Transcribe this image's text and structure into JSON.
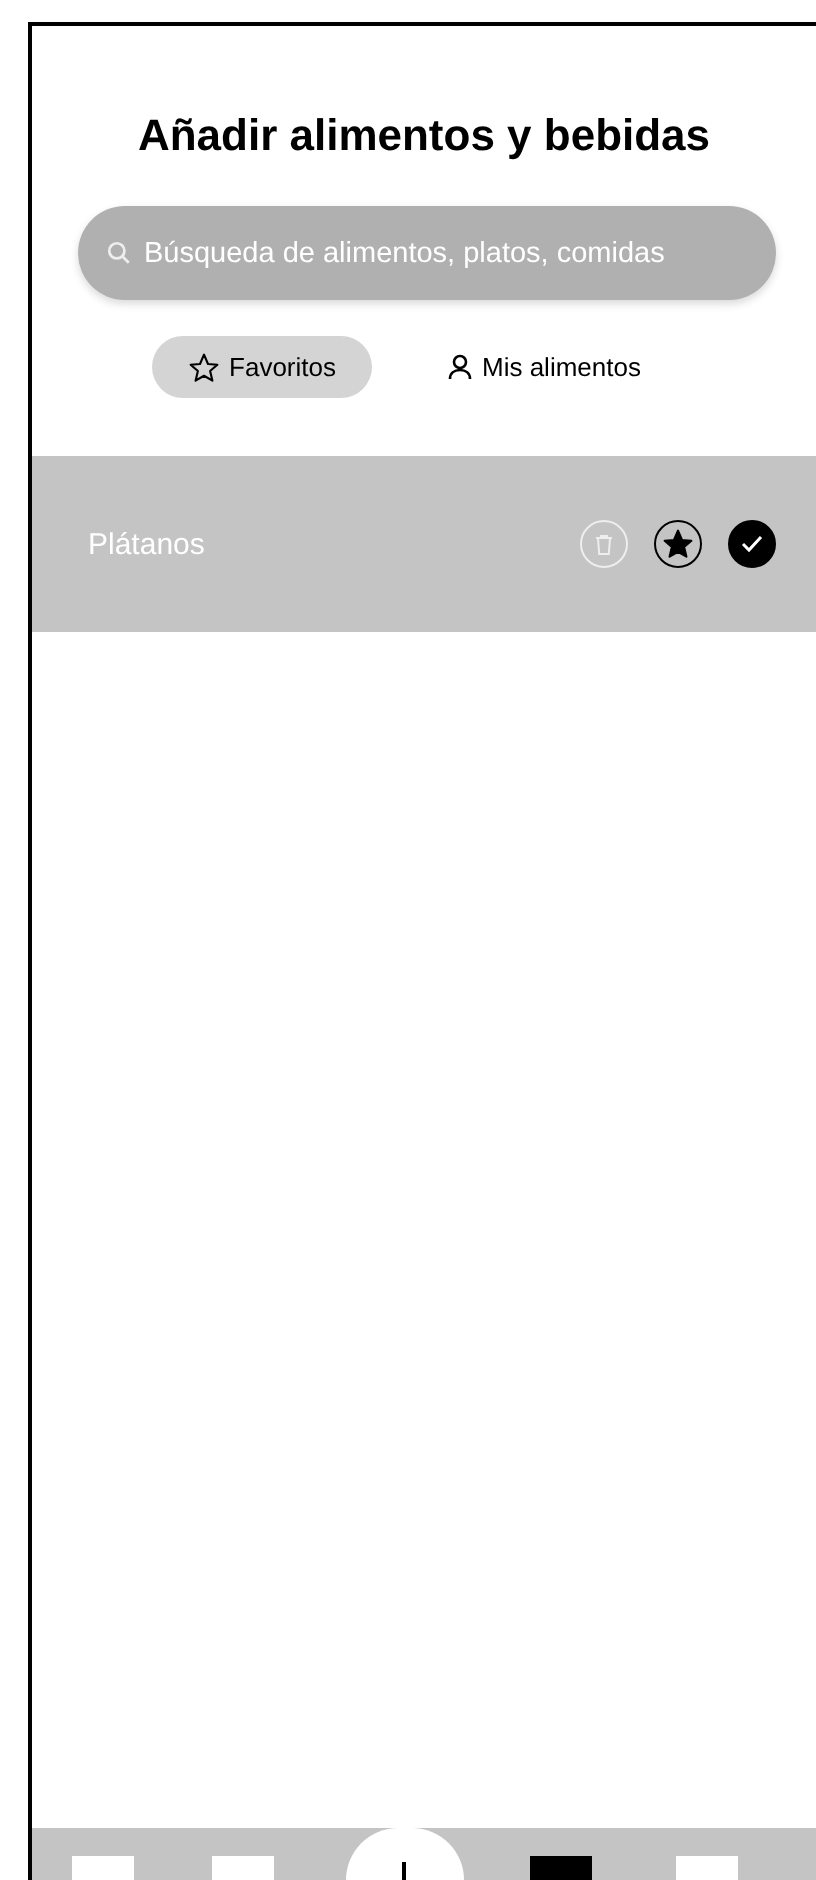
{
  "title": "Añadir alimentos y bebidas",
  "search": {
    "placeholder": "Búsqueda de alimentos, platos, comidas"
  },
  "tabs": [
    {
      "label": "Favoritos",
      "kind": "star",
      "selected": true
    },
    {
      "label": "Mis alimentos",
      "kind": "person",
      "selected": false
    }
  ],
  "items": [
    {
      "name": "Plátanos",
      "favorite": true,
      "checked": true
    }
  ],
  "nav": [
    {
      "kind": "square",
      "selected": false
    },
    {
      "kind": "square",
      "selected": false
    },
    {
      "kind": "add",
      "selected": false
    },
    {
      "kind": "square",
      "selected": true
    },
    {
      "kind": "square",
      "selected": false
    }
  ]
}
